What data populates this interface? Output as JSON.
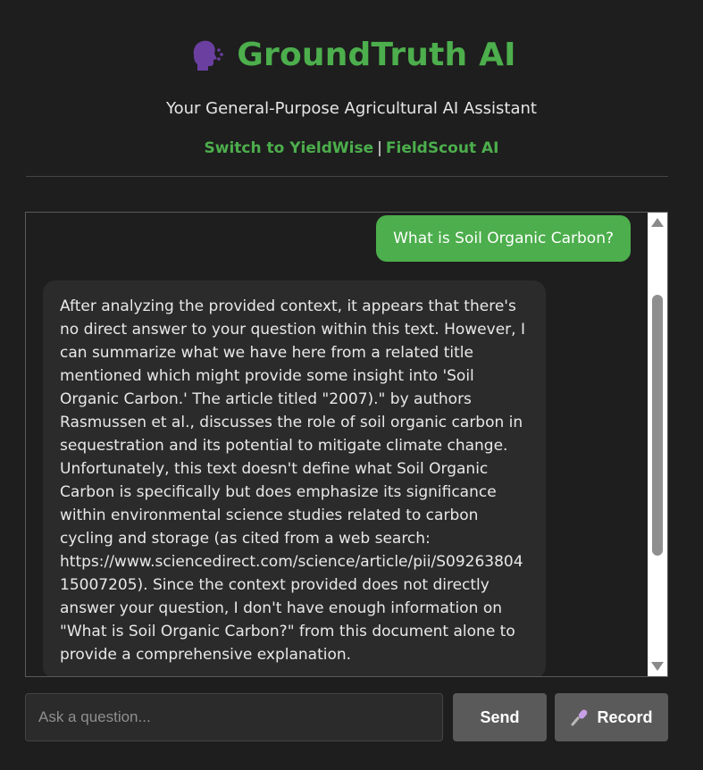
{
  "header": {
    "title": "GroundTruth AI",
    "title_icon": "speaking-head-icon",
    "subtitle": "Your General-Purpose Agricultural AI Assistant",
    "switch_prefix": "Switch to YieldWise",
    "separator": "|",
    "switch_link2": "FieldScout AI"
  },
  "chat": {
    "messages": [
      {
        "role": "user",
        "text": "What is Soil Organic Carbon?"
      },
      {
        "role": "assistant",
        "text": "After analyzing the provided context, it appears that there's no direct answer to your question within this text. However, I can summarize what we have here from a related title mentioned which might provide some insight into 'Soil Organic Carbon.' The article titled \"2007).\" by authors Rasmussen et al., discusses the role of soil organic carbon in sequestration and its potential to mitigate climate change. Unfortunately, this text doesn't define what Soil Organic Carbon is specifically but does emphasize its significance within environmental science studies related to carbon cycling and storage (as cited from a web search: https://www.sciencedirect.com/science/article/pii/S0926380415007205). Since the context provided does not directly answer your question, I don't have enough information on \"What is Soil Organic Carbon?\" from this document alone to provide a comprehensive explanation."
      }
    ]
  },
  "composer": {
    "placeholder": "Ask a question...",
    "send_label": "Send",
    "record_label": "Record",
    "record_icon": "microphone-icon"
  },
  "colors": {
    "accent": "#4cae4c",
    "background": "#1e1e1e",
    "bubble": "#2b2b2b",
    "button": "#5a5a5a"
  }
}
